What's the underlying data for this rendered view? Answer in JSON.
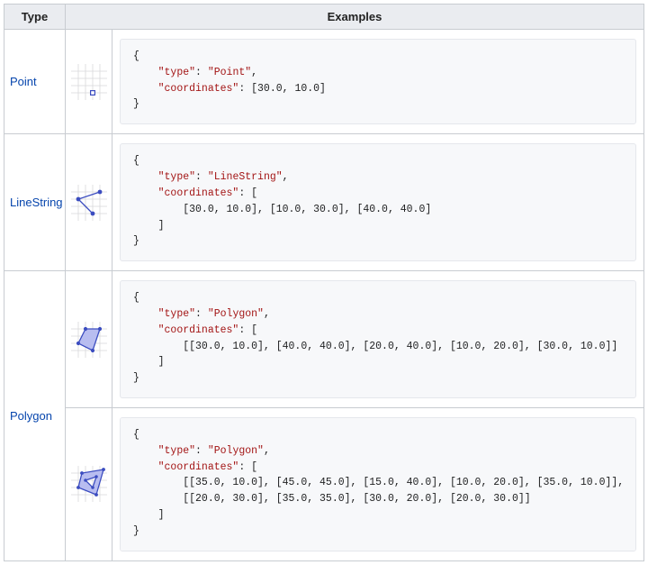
{
  "headers": {
    "type": "Type",
    "examples": "Examples"
  },
  "rows": {
    "point": {
      "label": "Point",
      "code_lines": [
        "{",
        "    <k>\"type\"</k>: <k>\"Point\"</k>,",
        "    <k>\"coordinates\"</k>: [30.0, 10.0]",
        "}"
      ]
    },
    "linestring": {
      "label": "LineString",
      "code_lines": [
        "{",
        "    <k>\"type\"</k>: <k>\"LineString\"</k>,",
        "    <k>\"coordinates\"</k>: [",
        "        [30.0, 10.0], [10.0, 30.0], [40.0, 40.0]",
        "    ]",
        "}"
      ]
    },
    "polygon1": {
      "label": "Polygon",
      "code_lines": [
        "{",
        "    <k>\"type\"</k>: <k>\"Polygon\"</k>,",
        "    <k>\"coordinates\"</k>: [",
        "        [[30.0, 10.0], [40.0, 40.0], [20.0, 40.0], [10.0, 20.0], [30.0, 10.0]]",
        "    ]",
        "}"
      ]
    },
    "polygon2": {
      "code_lines": [
        "{",
        "    <k>\"type\"</k>: <k>\"Polygon\"</k>,",
        "    <k>\"coordinates\"</k>: [",
        "        [[35.0, 10.0], [45.0, 45.0], [15.0, 40.0], [10.0, 20.0], [35.0, 10.0]],",
        "        [[20.0, 30.0], [35.0, 35.0], [30.0, 20.0], [20.0, 30.0]]",
        "    ]",
        "}"
      ]
    }
  }
}
